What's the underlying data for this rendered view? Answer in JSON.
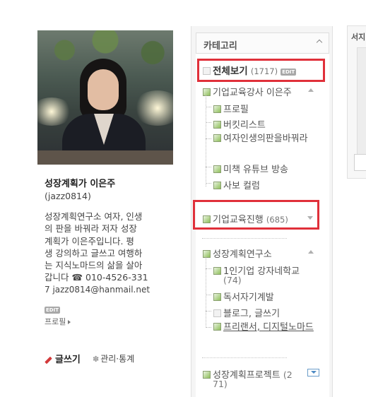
{
  "profile": {
    "name": "성장계획가 이은주",
    "user_id": "(jazz0814)",
    "intro_lines": [
      "성장계획연구소 여자, 인생",
      "의 판을 바꿔라 저자  성장",
      "계획가 이은주입니다. 평",
      "생 강의하고 글쓰고 여행하",
      "는 지식노마드의 삶을 살아",
      "갑니다 ☎ 010-4526-331",
      "7 jazz0814@hanmail.net"
    ],
    "edit_badge": "EDIT",
    "profile_link": "프로필",
    "write_label": "글쓰기",
    "manage_label": "관리·통계"
  },
  "category": {
    "title": "카테고리",
    "all": {
      "label": "전체보기",
      "count": "(1717)",
      "badge": "EDIT"
    },
    "groups": [
      {
        "label": "기업교육강사 이은주",
        "items": [
          "프로필",
          "버킷리스트",
          "여자인생의판을바꿔라",
          "미책 유튜브 방송",
          "사보 컬럼"
        ]
      },
      {
        "label": "기업교육진행",
        "count": "(685)",
        "items": []
      },
      {
        "label": "성장계획연구소",
        "items": [
          "1인기업 강자네학교",
          "독서자기계발",
          "블로그, 글쓰기",
          "프리랜서, 디지털노마드"
        ],
        "first_count": "(74)"
      },
      {
        "label": "성장계획프로젝트",
        "count_lines": [
          "(2",
          "71)"
        ]
      }
    ]
  },
  "right_panel": {
    "tab_label": "서지"
  },
  "colors": {
    "highlight": "#e0303a",
    "accent_link": "#4f8bc4"
  }
}
